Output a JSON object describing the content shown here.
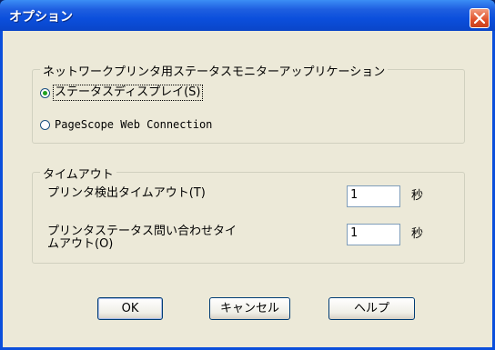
{
  "window": {
    "title": "オプション"
  },
  "group_app": {
    "label": "ネットワークプリンタ用ステータスモニターアップリケーション",
    "options": [
      {
        "label": "ステータスディスプレイ(S)",
        "checked": true
      },
      {
        "label": "PageScope Web Connection",
        "checked": false
      }
    ]
  },
  "group_timeout": {
    "label": "タイムアウト",
    "rows": [
      {
        "label": "プリンタ検出タイムアウト(T)",
        "value": "1",
        "unit": "秒"
      },
      {
        "label_line1": "プリンタステータス問い合わせタイ",
        "label_line2": "ムアウト(O)",
        "value": "1",
        "unit": "秒"
      }
    ]
  },
  "buttons": {
    "ok": "OK",
    "cancel": "キャンセル",
    "help": "ヘルプ"
  },
  "colors": {
    "titlebar": "#0b4fdc",
    "dialog_bg": "#ece9d8",
    "close_button": "#e0502a"
  }
}
